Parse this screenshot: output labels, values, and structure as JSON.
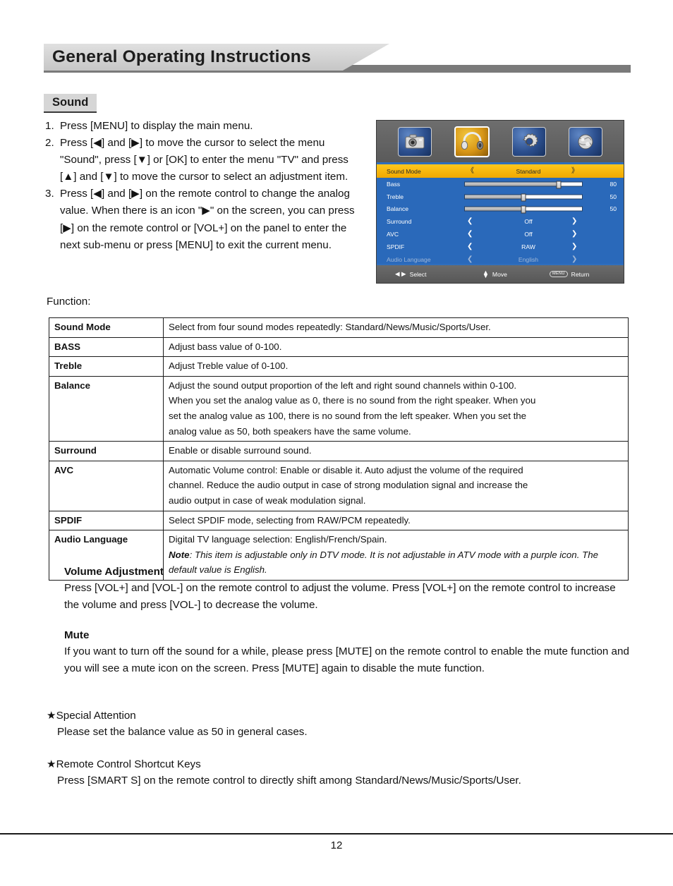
{
  "header": {
    "chapter_title": "General Operating Instructions"
  },
  "section": {
    "label": "Sound"
  },
  "steps": [
    {
      "num": "1.",
      "text": "Press [MENU] to display the main menu."
    },
    {
      "num": "2.",
      "text": "Press [◀] and [▶] to move the cursor to select the menu \"Sound\", press [▼] or [OK] to enter the menu \"TV\" and press [▲] and [▼] to move the cursor to select an adjustment item."
    },
    {
      "num": "3.",
      "text": "Press [◀] and [▶] on the remote control to change the analog value. When there is an icon \"▶\" on the screen, you can press [▶] on the remote control or [VOL+] on the panel to enter the next sub-menu or press [MENU] to exit the current menu."
    }
  ],
  "osd": {
    "icons": [
      {
        "name": "picture-icon",
        "selected": false
      },
      {
        "name": "sound-icon",
        "selected": true
      },
      {
        "name": "setup-icon",
        "selected": false
      },
      {
        "name": "channel-icon",
        "selected": false
      }
    ],
    "rows": [
      {
        "label": "Sound Mode",
        "type": "option",
        "value": "Standard",
        "highlight": true,
        "disabled": false,
        "arrow_left": "《",
        "arrow_right": "》"
      },
      {
        "label": "Bass",
        "type": "slider",
        "value": "80",
        "percent": 80,
        "highlight": false,
        "disabled": false
      },
      {
        "label": "Treble",
        "type": "slider",
        "value": "50",
        "percent": 50,
        "highlight": false,
        "disabled": false
      },
      {
        "label": "Balance",
        "type": "slider",
        "value": "50",
        "percent": 50,
        "highlight": false,
        "disabled": false
      },
      {
        "label": "Surround",
        "type": "option",
        "value": "Off",
        "highlight": false,
        "disabled": false,
        "arrow_left": "❮",
        "arrow_right": "❯"
      },
      {
        "label": "AVC",
        "type": "option",
        "value": "Off",
        "highlight": false,
        "disabled": false,
        "arrow_left": "❮",
        "arrow_right": "❯"
      },
      {
        "label": "SPDIF",
        "type": "option",
        "value": "RAW",
        "highlight": false,
        "disabled": false,
        "arrow_left": "❮",
        "arrow_right": "❯"
      },
      {
        "label": "Audio Language",
        "type": "option",
        "value": "English",
        "highlight": false,
        "disabled": true,
        "arrow_left": "❮",
        "arrow_right": "❯"
      }
    ],
    "footer": {
      "select_label": "Select",
      "select_arrows": "◀  ▶",
      "move_label": "Move",
      "menu_key": "MENU",
      "return_label": "Return"
    },
    "colors": {
      "panel_bg": "#5c5c5c",
      "list_bg": "#2a69ba",
      "highlight": "#f5b800",
      "divider": "#2f6fbd",
      "disabled_text": "#9fb6d6"
    }
  },
  "function_label": "Function:",
  "table": {
    "rows": [
      {
        "key": "Sound Mode",
        "lines": [
          "Select from four sound modes repeatedly: Standard/News/Music/Sports/User."
        ]
      },
      {
        "key": "BASS",
        "lines": [
          "Adjust bass value of 0-100."
        ]
      },
      {
        "key": "Treble",
        "lines": [
          "Adjust Treble value of 0-100."
        ]
      },
      {
        "key": "Balance",
        "lines": [
          "Adjust the sound output proportion of the left and right sound channels within 0-100.",
          "When you set the analog value as 0, there is no sound from the right speaker. When you",
          "set the analog value as 100, there is no sound from the left speaker. When you set the",
          "analog value as 50, both speakers have the same volume."
        ]
      },
      {
        "key": "Surround",
        "lines": [
          "Enable or disable surround sound."
        ]
      },
      {
        "key": "AVC",
        "lines": [
          "Automatic Volume control: Enable or disable it. Auto adjust the volume of the required",
          "channel. Reduce the audio output in case of strong modulation signal and increase the",
          "audio output in case of weak modulation signal."
        ]
      },
      {
        "key": "SPDIF",
        "lines": [
          "Select SPDIF mode, selecting from RAW/PCM repeatedly."
        ]
      },
      {
        "key": "Audio Language",
        "lines": [
          "Digital TV language selection: English/French/Spain."
        ],
        "note_prefix": "Note",
        "note_text": ": This item is adjustable only in DTV mode. It is not adjustable in ATV mode with a purple icon. The default value is English."
      }
    ]
  },
  "volume_block": {
    "heading": "Volume Adjustment",
    "body": "Press [VOL+] and [VOL-] on the remote control to adjust the volume. Press [VOL+] on the remote control to increase the volume and press [VOL-] to decrease the volume."
  },
  "mute_block": {
    "heading": "Mute",
    "body": "If you want to turn off the sound for a while, please press [MUTE] on the remote control to enable the mute function and you will see a mute icon on the screen. Press [MUTE] again to disable the mute function."
  },
  "special_block": {
    "heading": "★Special Attention",
    "body": "Please set the balance value as 50 in general cases."
  },
  "shortcut_block": {
    "heading": "★Remote Control Shortcut Keys",
    "body": "Press [SMART S] on the remote control to directly shift among Standard/News/Music/Sports/User."
  },
  "footer": {
    "page_number": "12"
  }
}
